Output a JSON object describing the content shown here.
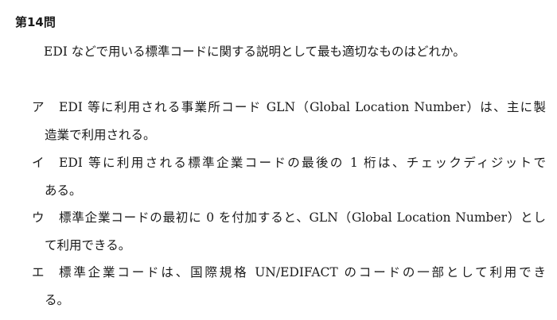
{
  "question": {
    "title": "第14問",
    "stem": "EDI などで用いる標準コードに関する説明として最も適切なものはどれか。"
  },
  "choices": [
    {
      "mark": "ア",
      "line1": "EDI 等に利用される事業所コード GLN（Global Location Number）は、主に製",
      "line2": "造業で利用される。"
    },
    {
      "mark": "イ",
      "line1": "EDI 等に利用される標準企業コードの最後の 1 桁は、チェックディジットで",
      "line2": "ある。"
    },
    {
      "mark": "ウ",
      "line1": "標準企業コードの最初に 0 を付加すると、GLN（Global Location Number）とし",
      "line2": "て利用できる。"
    },
    {
      "mark": "エ",
      "line1": "標準企業コードは、国際規格 UN/EDIFACT のコードの一部として利用でき",
      "line2": "る。"
    }
  ]
}
